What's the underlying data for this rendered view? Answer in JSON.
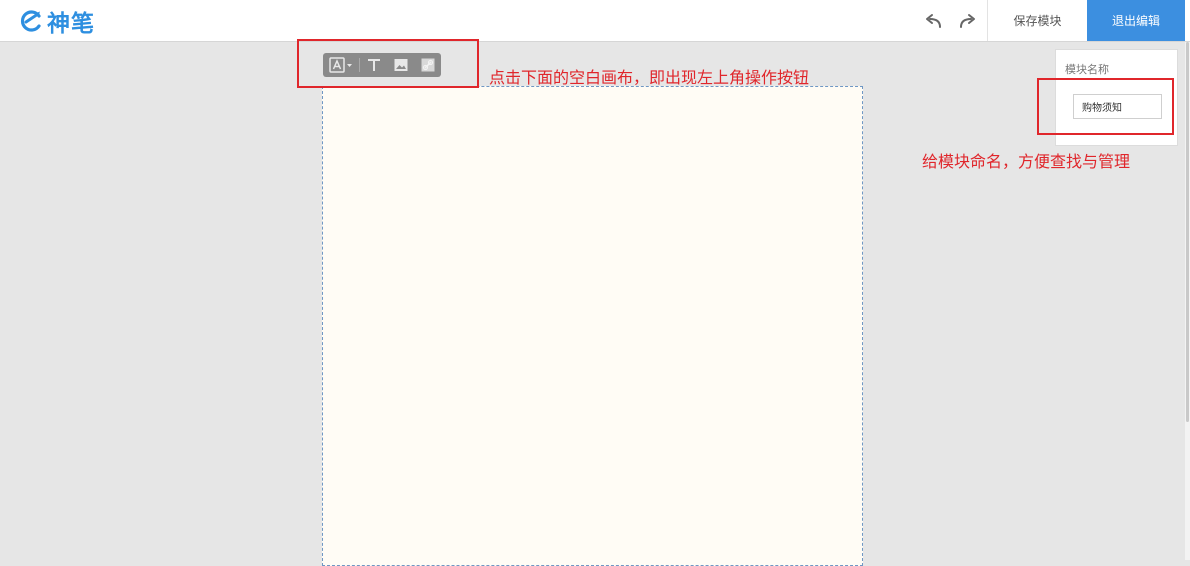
{
  "app": {
    "logo_text": "神笔"
  },
  "header": {
    "undo_icon": "undo-arrow-icon",
    "redo_icon": "redo-arrow-icon",
    "save_label": "保存模块",
    "exit_label": "退出编辑"
  },
  "toolbar": {
    "buttons": [
      {
        "icon": "font-a-dropdown-icon"
      },
      {
        "icon": "text-t-icon"
      },
      {
        "icon": "image-icon"
      },
      {
        "icon": "link-icon"
      }
    ]
  },
  "annotations": {
    "canvas_hint": "点击下面的空白画布，即出现左上角操作按钮",
    "name_hint": "给模块命名，方便查找与管理"
  },
  "module_panel": {
    "title": "模块名称",
    "name_value": "购物须知"
  },
  "colors": {
    "brand_blue": "#3c8fe0",
    "annotation_red": "#e0262b",
    "canvas_bg": "#fffcf5",
    "page_bg": "#e6e6e6"
  }
}
